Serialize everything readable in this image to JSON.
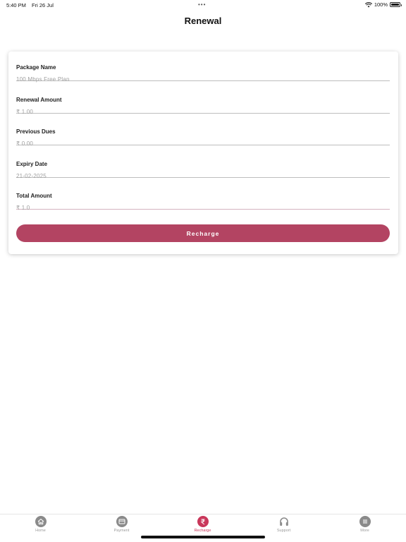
{
  "status": {
    "time": "5:40 PM",
    "date": "Fri 26 Jul",
    "battery": "100%",
    "battery_level": 1.0,
    "dots": "•••"
  },
  "header": {
    "title": "Renewal"
  },
  "form": {
    "fields": [
      {
        "label": "Package Name",
        "value": "100 Mbps Free Plan"
      },
      {
        "label": "Renewal Amount",
        "value": "₹ 1.00"
      },
      {
        "label": "Previous Dues",
        "value": "₹ 0.00"
      },
      {
        "label": "Expiry Date",
        "value": "21-02-2025"
      },
      {
        "label": "Total Amount",
        "value": "₹ 1.0"
      }
    ],
    "submit_label": "Recharge"
  },
  "tabs": [
    {
      "label": "Home",
      "icon": "home-icon",
      "active": false
    },
    {
      "label": "Payment",
      "icon": "payment-icon",
      "active": false
    },
    {
      "label": "Recharge",
      "icon": "rupee-icon",
      "active": true
    },
    {
      "label": "Support",
      "icon": "headphones-icon",
      "active": false
    },
    {
      "label": "More",
      "icon": "menu-icon",
      "active": false
    }
  ],
  "colors": {
    "accent": "#b34462",
    "tab_active": "#c9375a",
    "tab_inactive": "#8a8a8a"
  }
}
